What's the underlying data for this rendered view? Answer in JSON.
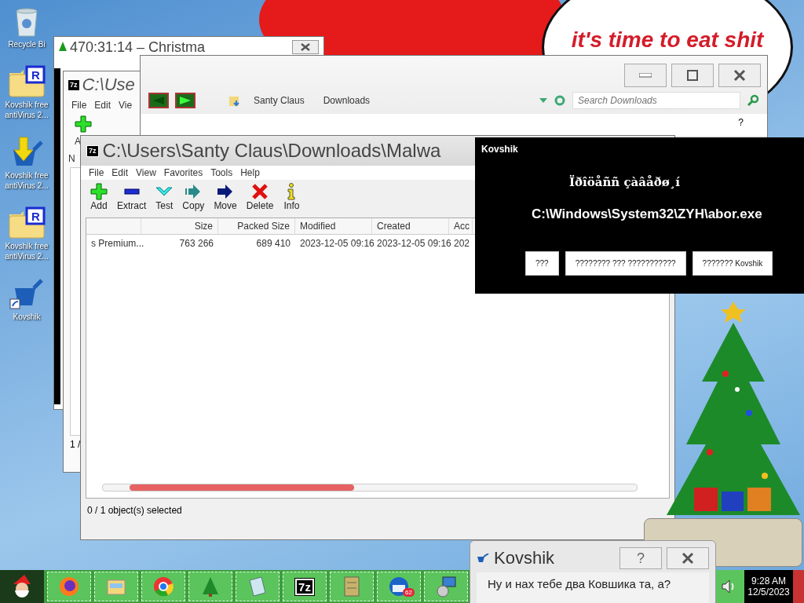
{
  "desktop": {
    "banner": "it's time to eat shit",
    "icons": [
      {
        "kind": "recycle",
        "label": "Recycle Bi"
      },
      {
        "kind": "folder-r",
        "mark": "R",
        "label": "Kovshik free antiVirus 2..."
      },
      {
        "kind": "download",
        "label": "Kovshik free antiVirus 2..."
      },
      {
        "kind": "folder-r",
        "mark": "R",
        "label": "Kovshik free antiVirus 2..."
      },
      {
        "kind": "ladle",
        "label": "Kovshik"
      }
    ]
  },
  "timer_window": {
    "title": "470:31:14 – Christma"
  },
  "back_archive_window": {
    "app_icon": "7z",
    "title": "C:\\Use",
    "menu": [
      "File",
      "Edit",
      "Vie"
    ],
    "toolbar_label": "A",
    "column": "N",
    "status": "1 /"
  },
  "explorer_window": {
    "breadcrumbs": [
      "Santy Claus",
      "Downloads"
    ],
    "search": {
      "placeholder": "Search Downloads"
    },
    "help": "?"
  },
  "archive_window": {
    "app_icon": "7z",
    "title": "C:\\Users\\Santy Claus\\Downloads\\Malwa",
    "menu": [
      "File",
      "Edit",
      "View",
      "Favorites",
      "Tools",
      "Help"
    ],
    "toolbar": [
      {
        "kind": "add",
        "label": "Add"
      },
      {
        "kind": "extract",
        "label": "Extract"
      },
      {
        "kind": "test",
        "label": "Test"
      },
      {
        "kind": "copy",
        "label": "Copy"
      },
      {
        "kind": "move",
        "label": "Move"
      },
      {
        "kind": "delete",
        "label": "Delete"
      },
      {
        "kind": "info",
        "label": "Info"
      }
    ],
    "columns": [
      "Size",
      "Packed Size",
      "Modified",
      "Created",
      "Acc"
    ],
    "rows": [
      {
        "name": "s Premium...",
        "cells": [
          "763 266",
          "689 410",
          "2023-12-05 09:16",
          "2023-12-05 09:16",
          "202"
        ]
      }
    ],
    "status": "0 / 1 object(s) selected"
  },
  "kovshik_dialog": {
    "title": "Kovshik",
    "message": "Ïðîöåññ çàâåðø¸í",
    "path": "C:\\Windows\\System32\\ZYH\\abor.exe",
    "buttons": [
      "???",
      "???????? ??? ???????????",
      "??????? Kovshik"
    ]
  },
  "question_dialog": {
    "title": "Kovshik",
    "help": "?",
    "message": "Ну и нах тебе два Ковшика та, а?"
  },
  "taskbar": {
    "apps": [
      {
        "kind": "firefox"
      },
      {
        "kind": "files"
      },
      {
        "kind": "chrome"
      },
      {
        "kind": "tree"
      },
      {
        "kind": "notepad"
      },
      {
        "kind": "sevenzip",
        "label": "7z"
      },
      {
        "kind": "archive"
      },
      {
        "kind": "mail",
        "badge": "62"
      },
      {
        "kind": "installer"
      }
    ],
    "time": "9:28 AM",
    "date": "12/5/2023"
  }
}
